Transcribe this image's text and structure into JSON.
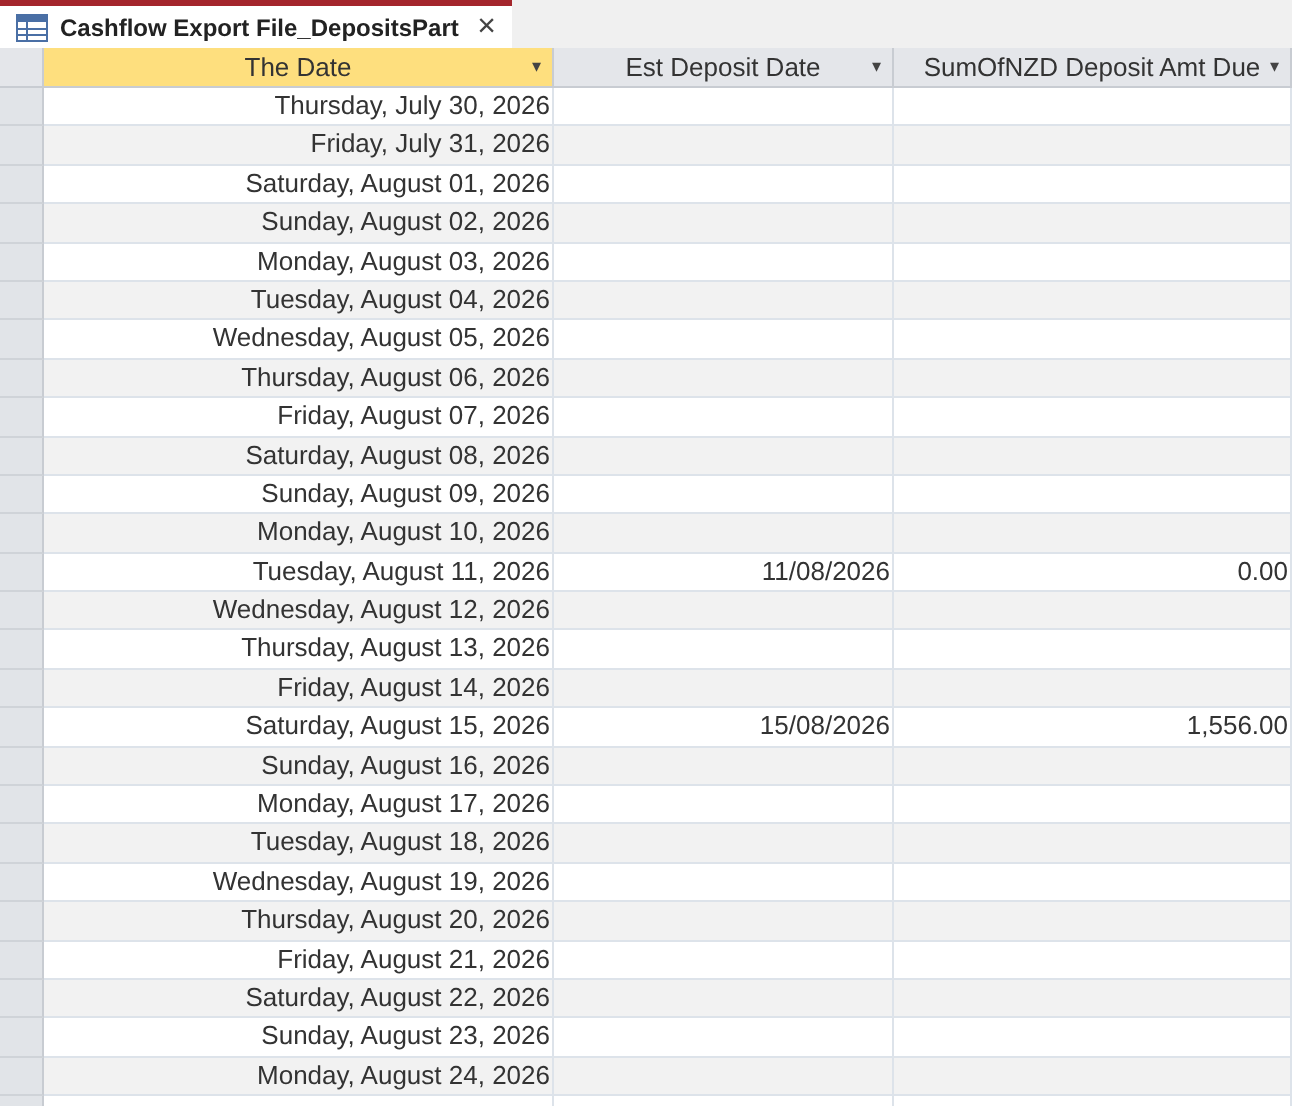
{
  "tab": {
    "title": "Cashflow Export File_DepositsPart",
    "close": "×"
  },
  "columns": [
    {
      "label": "The Date",
      "selected": true,
      "dropdown": "▾"
    },
    {
      "label": "Est Deposit Date",
      "selected": false,
      "dropdown": "▾"
    },
    {
      "label": "SumOfNZD Deposit Amt Due",
      "selected": false,
      "dropdown": "▾"
    }
  ],
  "rows": [
    {
      "date": "Thursday, July 30, 2026"
    },
    {
      "date": "Friday, July 31, 2026"
    },
    {
      "date": "Saturday, August 01, 2026"
    },
    {
      "date": "Sunday, August 02, 2026"
    },
    {
      "date": "Monday, August 03, 2026"
    },
    {
      "date": "Tuesday, August 04, 2026"
    },
    {
      "date": "Wednesday, August 05, 2026"
    },
    {
      "date": "Thursday, August 06, 2026"
    },
    {
      "date": "Friday, August 07, 2026"
    },
    {
      "date": "Saturday, August 08, 2026"
    },
    {
      "date": "Sunday, August 09, 2026"
    },
    {
      "date": "Monday, August 10, 2026"
    },
    {
      "date": "Tuesday, August 11, 2026",
      "est": "11/08/2026",
      "amount": "0.00"
    },
    {
      "date": "Wednesday, August 12, 2026"
    },
    {
      "date": "Thursday, August 13, 2026"
    },
    {
      "date": "Friday, August 14, 2026"
    },
    {
      "date": "Saturday, August 15, 2026",
      "est": "15/08/2026",
      "amount": "1,556.00"
    },
    {
      "date": "Sunday, August 16, 2026"
    },
    {
      "date": "Monday, August 17, 2026"
    },
    {
      "date": "Tuesday, August 18, 2026"
    },
    {
      "date": "Wednesday, August 19, 2026"
    },
    {
      "date": "Thursday, August 20, 2026"
    },
    {
      "date": "Friday, August 21, 2026"
    },
    {
      "date": "Saturday, August 22, 2026"
    },
    {
      "date": "Sunday, August 23, 2026"
    },
    {
      "date": "Monday, August 24, 2026"
    }
  ]
}
